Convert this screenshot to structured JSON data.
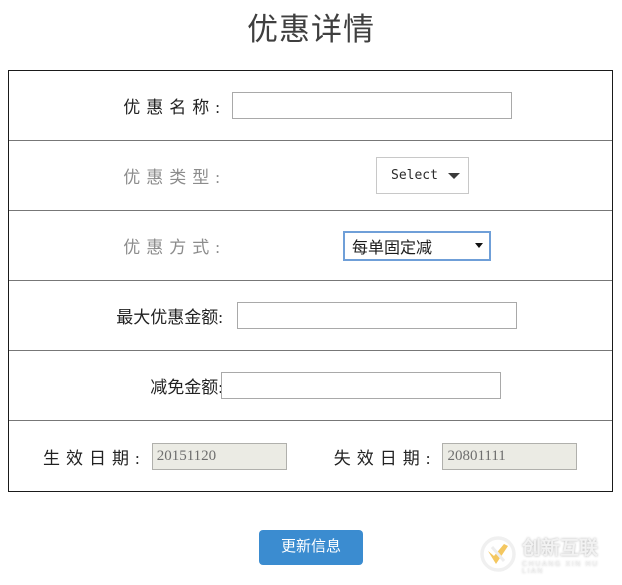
{
  "page": {
    "title": "优惠详情"
  },
  "form": {
    "rows": [
      {
        "label": "优惠名称:",
        "field_type": "text",
        "value": "",
        "placeholder": ""
      },
      {
        "label": "优惠类型:",
        "field_type": "select",
        "value": "Select"
      },
      {
        "label": "优惠方式:",
        "field_type": "select-focused",
        "value": "每单固定减"
      },
      {
        "label": "最大优惠金额:",
        "field_type": "text",
        "value": "",
        "placeholder": ""
      },
      {
        "label": "减免金额:",
        "field_type": "text",
        "value": "",
        "placeholder": ""
      }
    ],
    "dates": {
      "start_label": "生效日期:",
      "start_value": "20151120",
      "end_label": "失效日期:",
      "end_value": "20801111"
    }
  },
  "actions": {
    "submit_label": "更新信息"
  },
  "watermark": {
    "cn": "创新互联",
    "en": "CHUANG XIN HU LIAN"
  },
  "colors": {
    "button_blue": "#3b8cd0",
    "focus_border": "#6f9fd8",
    "table_border": "#1a1a1a",
    "row_divider": "#777777",
    "disabled_bg": "#ebebe4",
    "logo_orange": "#f2b233"
  }
}
